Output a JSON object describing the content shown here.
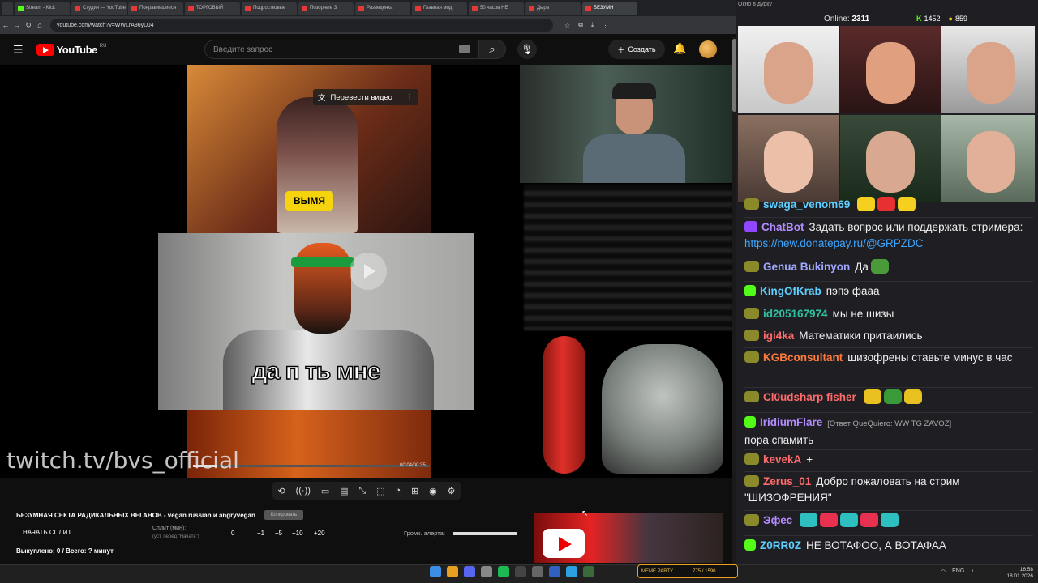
{
  "browser": {
    "tabs": [
      {
        "label": "Stream - Kick",
        "type": "kick"
      },
      {
        "label": "Студия — YouTube",
        "type": "yt"
      },
      {
        "label": "Понравившиеся",
        "type": "yt"
      },
      {
        "label": "ТОРГОВЫЙ",
        "type": "yt"
      },
      {
        "label": "Подростковые",
        "type": "yt"
      },
      {
        "label": "Позорные З",
        "type": "yt"
      },
      {
        "label": "Разведенка",
        "type": "yt"
      },
      {
        "label": "Главная мод",
        "type": "yt"
      },
      {
        "label": "50 часов НЕ",
        "type": "yt"
      },
      {
        "label": "Дыра",
        "type": "yt"
      },
      {
        "label": "БЕЗУМН",
        "type": "yt",
        "active": true
      }
    ],
    "url": "youtube.com/watch?v=WWLrA86yUJ4"
  },
  "youtube": {
    "logo_text": "YouTube",
    "region": "RU",
    "search_placeholder": "Введите запрос",
    "create_label": "Создать"
  },
  "video": {
    "translate_label": "Перевести видео",
    "sticker_text": "ВЫМЯ",
    "meme_caption": "да п       ть мне",
    "time": "00:04/00:35",
    "progress": 0.1,
    "watermark": "twitch.tv/bvs_official"
  },
  "below": {
    "title": "БЕЗУМНАЯ СЕКТА РАДИКАЛЬНЫХ ВЕГАНОВ - vegan russian и angryvegan",
    "copy_label": "Копировать",
    "start_split": "НАЧАТЬ СПЛИТ",
    "split_label": "Сплит (мин):",
    "split_sub": "(уст. перед \"Начать\")",
    "split_value": "0",
    "steps": [
      "+1",
      "+5",
      "+10",
      "+20"
    ],
    "volume_label": "Громк. алерта:",
    "volume": 1.0,
    "bought": "Выкуплено: 0 / Всего: ? минут"
  },
  "panel": {
    "window_title": "Окно в дурку",
    "online_label": "Online:",
    "online_count": "2311",
    "kick_count": "1452",
    "coins_count": "859"
  },
  "chat": [
    {
      "user": "swaga_venom69",
      "color": "#5fd0ff",
      "text": "",
      "emotes": [
        "#f5d020",
        "#e83030",
        "#f5d020"
      ],
      "emote_text": "A   O"
    },
    {
      "user": "ChatBot",
      "color": "#b38cff",
      "text": "Задать вопрос или поддержать стримера:",
      "link": "https://new.donatepay.ru/@GRPZDC",
      "badge": "bot"
    },
    {
      "user": "Genua Bukinyon",
      "color": "#a0a8ff",
      "text": "Да",
      "emotes": [
        "#4a9a3a"
      ]
    },
    {
      "user": "KingOfKrab",
      "color": "#5fd0ff",
      "text": "пэпэ фааа",
      "badge": "kick"
    },
    {
      "user": "id205167974",
      "color": "#2ec0a0",
      "text": "мы не шизы"
    },
    {
      "user": "igi4ka",
      "color": "#ff6b6b",
      "text": "Математики притаились"
    },
    {
      "user": "KGBconsultant",
      "color": "#ff7a3a",
      "text": "шизофрены ставьте минус в час"
    },
    {
      "user": "Cl0udsharp fisher",
      "color": "#ff6b6b",
      "text": "",
      "emotes": [
        "#e8c020",
        "#3a9a3a",
        "#e8c020"
      ]
    },
    {
      "user": "IridiumFlare",
      "color": "#b38cff",
      "reply": "[Ответ QueQuiero: WW TG ZAVOZ]",
      "text": "пора спамить",
      "badge": "kick"
    },
    {
      "user": "kevekA",
      "color": "#ff6b6b",
      "text": "+"
    },
    {
      "user": "Zerus_01",
      "color": "#ff6b6b",
      "text": "Добро пожаловать на стрим \"ШИЗОФРЕНИЯ\""
    },
    {
      "user": "Эфес",
      "color": "#b38cff",
      "text": "",
      "emotes": [
        "#2ec0c0",
        "#e83050",
        "#2ec0c0",
        "#e83050",
        "#2ec0c0"
      ]
    },
    {
      "user": "Z0RR0Z",
      "color": "#5fd0ff",
      "text": "НЕ ВОТАФОО, А ВОТАФАА",
      "badge": "kick"
    }
  ],
  "taskbar": {
    "lang": "ENG",
    "time": "16:58",
    "date": "18.01.2026",
    "memeparty": "MEME PARTY",
    "memeparty_count": "775 / 1590"
  }
}
